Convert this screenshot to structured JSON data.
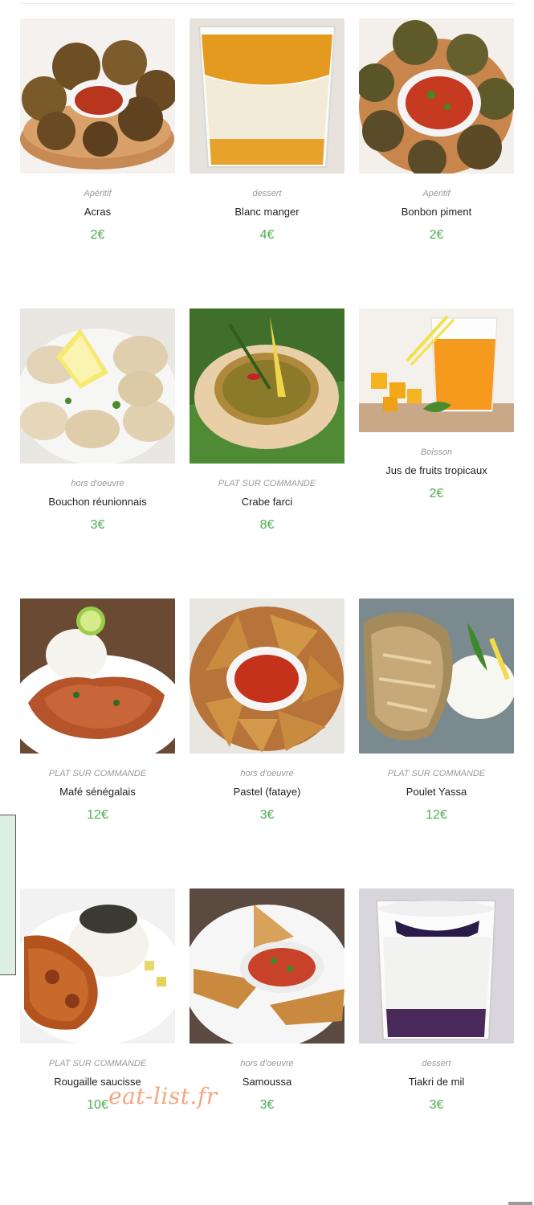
{
  "watermark": "eat-list.fr",
  "colors": {
    "price": "#4caf50",
    "category": "#9a9a9a",
    "name": "#222222"
  },
  "items": [
    {
      "category": "Apéritif",
      "name": "Acras",
      "price": "2€",
      "image": "fritters-bowl-with-sauce"
    },
    {
      "category": "dessert",
      "name": "Blanc manger",
      "price": "4€",
      "image": "layered-dessert-glass"
    },
    {
      "category": "Apéritif",
      "name": "Bonbon piment",
      "price": "2€",
      "image": "fritters-bowl-with-salsa"
    },
    {
      "category": "hors d'oeuvre",
      "name": "Bouchon réunionnais",
      "price": "3€",
      "image": "dumplings-with-lemon"
    },
    {
      "category": "PLAT SUR COMMANDE",
      "name": "Crabe farci",
      "price": "8€",
      "image": "stuffed-crab-shell"
    },
    {
      "category": "Boisson",
      "name": "Jus de fruits tropicaux",
      "price": "2€",
      "image": "juice-glass-with-mango"
    },
    {
      "category": "PLAT SUR COMMANDE",
      "name": "Mafé sénégalais",
      "price": "12€",
      "image": "stew-with-rice"
    },
    {
      "category": "hors d'oeuvre",
      "name": "Pastel (fataye)",
      "price": "3€",
      "image": "turnovers-with-sauce"
    },
    {
      "category": "PLAT SUR COMMANDE",
      "name": "Poulet Yassa",
      "price": "12€",
      "image": "chicken-with-onions-rice"
    },
    {
      "category": "PLAT SUR COMMANDE",
      "name": "Rougaille saucisse",
      "price": "10€",
      "image": "sausage-rougail-rice"
    },
    {
      "category": "hors d'oeuvre",
      "name": "Samoussa",
      "price": "3€",
      "image": "samosas-with-salsa"
    },
    {
      "category": "dessert",
      "name": "Tiakri de mil",
      "price": "3€",
      "image": "millet-dessert-glass"
    }
  ]
}
